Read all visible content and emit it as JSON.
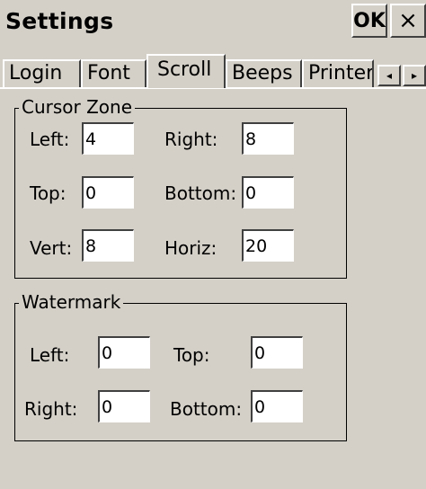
{
  "window": {
    "title": "Settings",
    "ok_label": "OK",
    "close_label": "×"
  },
  "tabs": [
    {
      "label": "Login"
    },
    {
      "label": "Font"
    },
    {
      "label": "Scroll",
      "active": true
    },
    {
      "label": "Beeps"
    },
    {
      "label": "Printer"
    }
  ],
  "tab_scroll": {
    "left_arrow": "◂",
    "right_arrow": "▸"
  },
  "cursor_zone": {
    "title": "Cursor Zone",
    "left_label": "Left:",
    "left_value": "4",
    "right_label": "Right:",
    "right_value": "8",
    "top_label": "Top:",
    "top_value": "0",
    "bottom_label": "Bottom:",
    "bottom_value": "0",
    "vert_label": "Vert:",
    "vert_value": "8",
    "horiz_label": "Horiz:",
    "horiz_value": "20"
  },
  "watermark": {
    "title": "Watermark",
    "left_label": "Left:",
    "left_value": "0",
    "top_label": "Top:",
    "top_value": "0",
    "right_label": "Right:",
    "right_value": "0",
    "bottom_label": "Bottom:",
    "bottom_value": "0"
  },
  "colors": {
    "background": "#d4d0c8",
    "field_background": "#ffffff",
    "text": "#000000"
  }
}
